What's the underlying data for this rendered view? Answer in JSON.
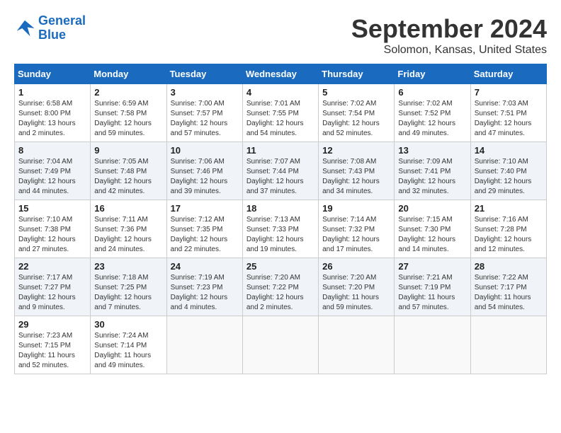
{
  "header": {
    "logo_line1": "General",
    "logo_line2": "Blue",
    "title": "September 2024",
    "subtitle": "Solomon, Kansas, United States"
  },
  "weekdays": [
    "Sunday",
    "Monday",
    "Tuesday",
    "Wednesday",
    "Thursday",
    "Friday",
    "Saturday"
  ],
  "weeks": [
    [
      {
        "day": "1",
        "sunrise": "6:58 AM",
        "sunset": "8:00 PM",
        "daylight": "13 hours and 2 minutes."
      },
      {
        "day": "2",
        "sunrise": "6:59 AM",
        "sunset": "7:58 PM",
        "daylight": "12 hours and 59 minutes."
      },
      {
        "day": "3",
        "sunrise": "7:00 AM",
        "sunset": "7:57 PM",
        "daylight": "12 hours and 57 minutes."
      },
      {
        "day": "4",
        "sunrise": "7:01 AM",
        "sunset": "7:55 PM",
        "daylight": "12 hours and 54 minutes."
      },
      {
        "day": "5",
        "sunrise": "7:02 AM",
        "sunset": "7:54 PM",
        "daylight": "12 hours and 52 minutes."
      },
      {
        "day": "6",
        "sunrise": "7:02 AM",
        "sunset": "7:52 PM",
        "daylight": "12 hours and 49 minutes."
      },
      {
        "day": "7",
        "sunrise": "7:03 AM",
        "sunset": "7:51 PM",
        "daylight": "12 hours and 47 minutes."
      }
    ],
    [
      {
        "day": "8",
        "sunrise": "7:04 AM",
        "sunset": "7:49 PM",
        "daylight": "12 hours and 44 minutes."
      },
      {
        "day": "9",
        "sunrise": "7:05 AM",
        "sunset": "7:48 PM",
        "daylight": "12 hours and 42 minutes."
      },
      {
        "day": "10",
        "sunrise": "7:06 AM",
        "sunset": "7:46 PM",
        "daylight": "12 hours and 39 minutes."
      },
      {
        "day": "11",
        "sunrise": "7:07 AM",
        "sunset": "7:44 PM",
        "daylight": "12 hours and 37 minutes."
      },
      {
        "day": "12",
        "sunrise": "7:08 AM",
        "sunset": "7:43 PM",
        "daylight": "12 hours and 34 minutes."
      },
      {
        "day": "13",
        "sunrise": "7:09 AM",
        "sunset": "7:41 PM",
        "daylight": "12 hours and 32 minutes."
      },
      {
        "day": "14",
        "sunrise": "7:10 AM",
        "sunset": "7:40 PM",
        "daylight": "12 hours and 29 minutes."
      }
    ],
    [
      {
        "day": "15",
        "sunrise": "7:10 AM",
        "sunset": "7:38 PM",
        "daylight": "12 hours and 27 minutes."
      },
      {
        "day": "16",
        "sunrise": "7:11 AM",
        "sunset": "7:36 PM",
        "daylight": "12 hours and 24 minutes."
      },
      {
        "day": "17",
        "sunrise": "7:12 AM",
        "sunset": "7:35 PM",
        "daylight": "12 hours and 22 minutes."
      },
      {
        "day": "18",
        "sunrise": "7:13 AM",
        "sunset": "7:33 PM",
        "daylight": "12 hours and 19 minutes."
      },
      {
        "day": "19",
        "sunrise": "7:14 AM",
        "sunset": "7:32 PM",
        "daylight": "12 hours and 17 minutes."
      },
      {
        "day": "20",
        "sunrise": "7:15 AM",
        "sunset": "7:30 PM",
        "daylight": "12 hours and 14 minutes."
      },
      {
        "day": "21",
        "sunrise": "7:16 AM",
        "sunset": "7:28 PM",
        "daylight": "12 hours and 12 minutes."
      }
    ],
    [
      {
        "day": "22",
        "sunrise": "7:17 AM",
        "sunset": "7:27 PM",
        "daylight": "12 hours and 9 minutes."
      },
      {
        "day": "23",
        "sunrise": "7:18 AM",
        "sunset": "7:25 PM",
        "daylight": "12 hours and 7 minutes."
      },
      {
        "day": "24",
        "sunrise": "7:19 AM",
        "sunset": "7:23 PM",
        "daylight": "12 hours and 4 minutes."
      },
      {
        "day": "25",
        "sunrise": "7:20 AM",
        "sunset": "7:22 PM",
        "daylight": "12 hours and 2 minutes."
      },
      {
        "day": "26",
        "sunrise": "7:20 AM",
        "sunset": "7:20 PM",
        "daylight": "11 hours and 59 minutes."
      },
      {
        "day": "27",
        "sunrise": "7:21 AM",
        "sunset": "7:19 PM",
        "daylight": "11 hours and 57 minutes."
      },
      {
        "day": "28",
        "sunrise": "7:22 AM",
        "sunset": "7:17 PM",
        "daylight": "11 hours and 54 minutes."
      }
    ],
    [
      {
        "day": "29",
        "sunrise": "7:23 AM",
        "sunset": "7:15 PM",
        "daylight": "11 hours and 52 minutes."
      },
      {
        "day": "30",
        "sunrise": "7:24 AM",
        "sunset": "7:14 PM",
        "daylight": "11 hours and 49 minutes."
      },
      null,
      null,
      null,
      null,
      null
    ]
  ]
}
